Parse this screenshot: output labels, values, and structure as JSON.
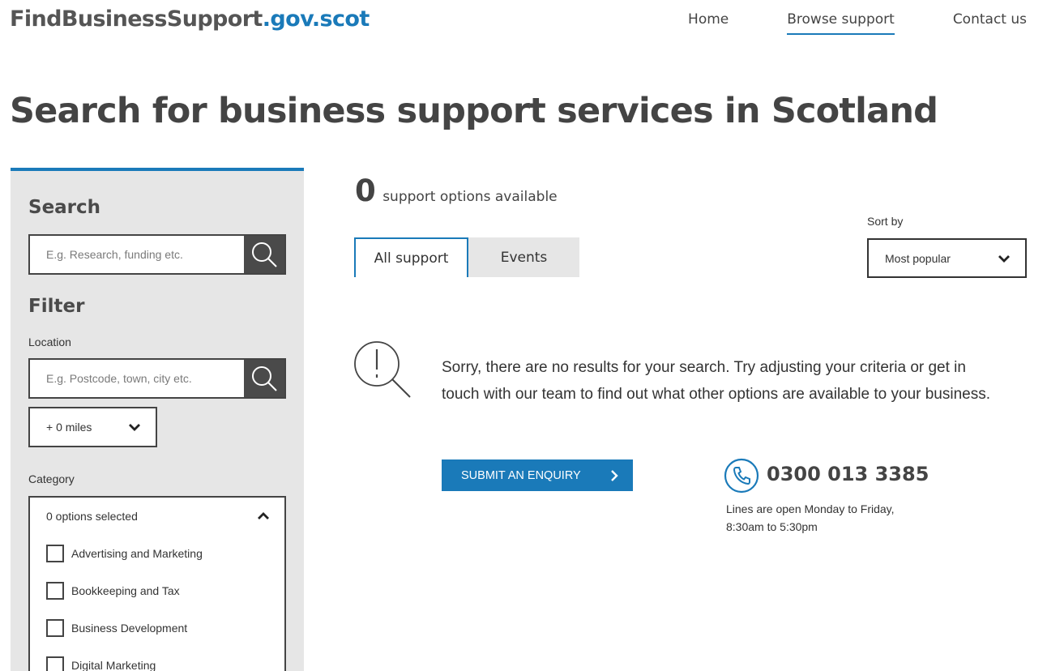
{
  "header": {
    "logo_main": "FindBusinessSupport",
    "logo_accent": ".gov.scot",
    "nav": [
      {
        "label": "Home"
      },
      {
        "label": "Browse support"
      },
      {
        "label": "Contact us"
      }
    ],
    "active_nav": "Browse support"
  },
  "page_title": "Search for business support services in Scotland",
  "sidebar": {
    "search_heading": "Search",
    "search_placeholder": "E.g. Research, funding etc.",
    "filter_heading": "Filter",
    "location_label": "Location",
    "location_placeholder": "E.g. Postcode, town, city etc.",
    "miles_value": "+ 0 miles",
    "category_label": "Category",
    "category_summary": "0 options selected",
    "categories": [
      {
        "label": "Advertising and Marketing",
        "checked": false
      },
      {
        "label": "Bookkeeping and Tax",
        "checked": false
      },
      {
        "label": "Business Development",
        "checked": false
      },
      {
        "label": "Digital Marketing",
        "checked": false
      }
    ]
  },
  "results": {
    "count": "0",
    "count_label": "support options available",
    "tabs": [
      {
        "label": "All support",
        "active": true
      },
      {
        "label": "Events",
        "active": false
      }
    ],
    "sort_label": "Sort by",
    "sort_value": "Most popular",
    "no_results_message": "Sorry, there are no results for your search. Try adjusting your criteria or get in touch with our team to find out what other options are available to your business.",
    "enquiry_button": "SUBMIT AN ENQUIRY",
    "phone_number": "0300 013 3385",
    "phone_hours": "Lines are open Monday to Friday, 8:30am to 5:30pm"
  },
  "colors": {
    "accent": "#1a7ab9",
    "sidebar_bg": "#e6e6e6",
    "dark_button": "#4a4a4a",
    "text": "#333333"
  },
  "icons": [
    "search-icon",
    "chevron-down-icon",
    "chevron-up-icon",
    "no-results-magnifier-icon",
    "chevron-right-icon",
    "phone-icon",
    "checkbox-icon"
  ]
}
